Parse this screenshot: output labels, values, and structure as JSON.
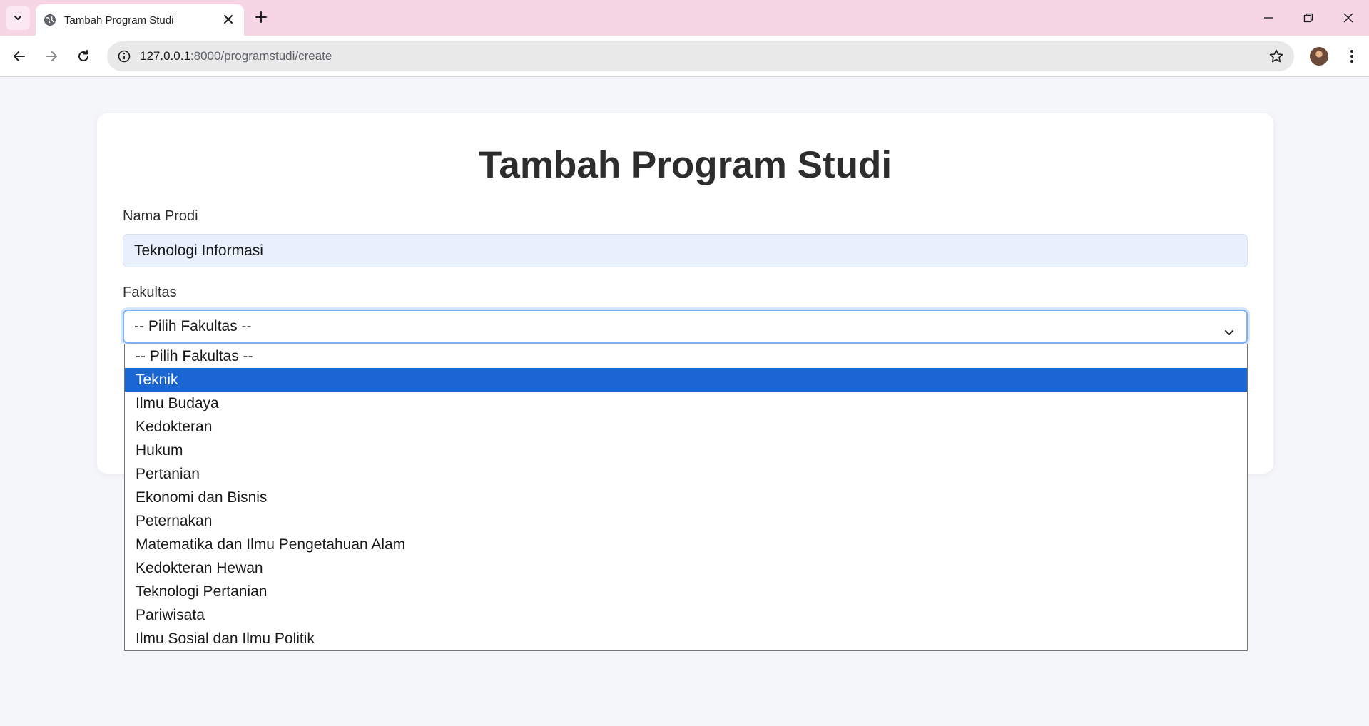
{
  "browser": {
    "tab_title": "Tambah Program Studi",
    "url_host": "127.0.0.1",
    "url_path": ":8000/programstudi/create"
  },
  "form": {
    "title": "Tambah Program Studi",
    "nama_prodi_label": "Nama Prodi",
    "nama_prodi_value": "Teknologi Informasi",
    "fakultas_label": "Fakultas",
    "fakultas_selected": "-- Pilih Fakultas --"
  },
  "dropdown": {
    "highlighted_index": 1,
    "options": [
      "-- Pilih Fakultas --",
      "Teknik",
      "Ilmu Budaya",
      "Kedokteran",
      "Hukum",
      "Pertanian",
      "Ekonomi dan Bisnis",
      "Peternakan",
      "Matematika dan Ilmu Pengetahuan Alam",
      "Kedokteran Hewan",
      "Teknologi Pertanian",
      "Pariwisata",
      "Ilmu Sosial dan Ilmu Politik"
    ]
  },
  "icons": {
    "tab_search": "chevron-down-icon",
    "favicon": "globe-icon",
    "tab_close": "close-icon",
    "new_tab": "plus-icon",
    "minimize": "minimize-icon",
    "restore": "restore-icon",
    "close_window": "close-icon",
    "back": "arrow-left-icon",
    "forward": "arrow-right-icon",
    "reload": "reload-icon",
    "site_info": "info-icon",
    "bookmark": "star-icon",
    "menu": "kebab-icon",
    "select_chevron": "chevron-down-icon"
  },
  "colors": {
    "tabstrip": "#f6d5e4",
    "highlight": "#1a66d2",
    "input_bg": "#e8f0fe",
    "focus_ring": "#7fb1f0"
  }
}
